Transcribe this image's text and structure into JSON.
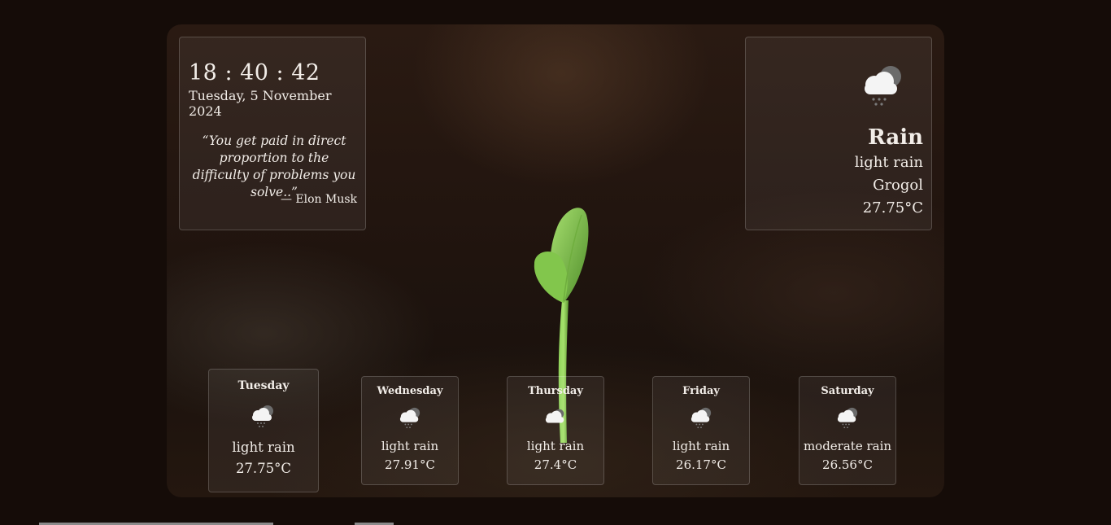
{
  "clock": {
    "time": "18 : 40 : 42",
    "date": "Tuesday, 5 November 2024"
  },
  "quote": {
    "text": "“You get paid in direct proportion to the difficulty of problems you solve..”",
    "author": "— Elon Musk"
  },
  "current_weather": {
    "icon": "rain-cloud-icon",
    "main": "Rain",
    "description": "light rain",
    "city": "Grogol",
    "temperature": "27.75°C"
  },
  "forecast": [
    {
      "day": "Tuesday",
      "icon": "rain-cloud-icon",
      "description": "light rain",
      "temperature": "27.75°C"
    },
    {
      "day": "Wednesday",
      "icon": "rain-cloud-icon",
      "description": "light rain",
      "temperature": "27.91°C"
    },
    {
      "day": "Thursday",
      "icon": "cloud-icon",
      "description": "light rain",
      "temperature": "27.4°C"
    },
    {
      "day": "Friday",
      "icon": "rain-cloud-icon",
      "description": "light rain",
      "temperature": "26.17°C"
    },
    {
      "day": "Saturday",
      "icon": "rain-cloud-icon",
      "description": "moderate rain",
      "temperature": "26.56°C"
    }
  ],
  "colors": {
    "page_background": "#150c08",
    "card_border": "#5e534c",
    "text": "#f2ede8",
    "sprout_green": "#7cc34a"
  }
}
